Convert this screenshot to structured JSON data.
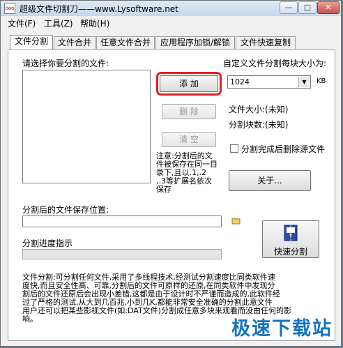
{
  "window": {
    "app_icon_text": "ooo",
    "title": "超级文件切割刀——www.Lysoftware.net",
    "minimize": "—",
    "maximize": "□",
    "close": "✕"
  },
  "menu": [
    {
      "label": "文件(F)"
    },
    {
      "label": "工具(Z)"
    },
    {
      "label": "帮助(H)"
    }
  ],
  "tabs": [
    {
      "label": "文件分割"
    },
    {
      "label": "文件合并"
    },
    {
      "label": "任意文件合并"
    },
    {
      "label": "应用程序加锁/解锁"
    },
    {
      "label": "文件快速复制"
    }
  ],
  "split": {
    "select_file_label": "请选择你要分割的文件:",
    "add_button": "添 加",
    "delete_button": "删 除",
    "clear_button": "清 空",
    "custom_size_label": "自定义文件分割每块大小为:",
    "size_value": "1024",
    "size_unit": "KB",
    "file_size_label": "文件大小:(未知)",
    "block_count_label": "分割块数:(未知)",
    "delete_source_label": "分割完成后删除源文件",
    "note_lines": [
      "注意:分割后的文",
      "件被保存在同一目",
      "录下,且以.1,.2",
      ",.3等扩展名依次",
      "保存"
    ],
    "about_button": "关于...",
    "save_location_label": "分割后的文件保存位置:",
    "save_location_value": "",
    "progress_label": "分割进度指示",
    "progress_value": 0,
    "quick_split_button": "快速分割",
    "description_lines": [
      "文件分割:可分割任何文件,采用了多线程技术,经测试分割速度比同类软件速",
      "度快,而且安全性高、可靠,分割后的文件可原样的还原,在同类软件中发现分",
      "割后的文件还原后会出现小差错,这都是由于设计时不严谨而造成的,此软件经",
      "过了严格的测试,从大到几百兆,小到几K,都能非常安全准确的分割此意文件",
      "用户还可以把某些影视文件(如:DAT文件)分割成任意多块来观看而没由任何的影",
      "响。"
    ]
  },
  "watermark": "极速下载站"
}
